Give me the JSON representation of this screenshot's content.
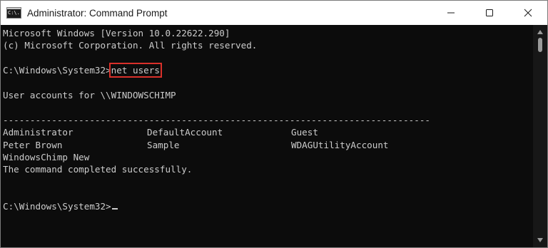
{
  "window": {
    "title": "Administrator: Command Prompt",
    "icon": "cmd-app-icon",
    "icon_glyph": "C:\\."
  },
  "controls": [
    "minimize-icon",
    "maximize-icon",
    "close-icon"
  ],
  "console": {
    "header1": "Microsoft Windows [Version 10.0.22622.290]",
    "header2": "(c) Microsoft Corporation. All rights reserved.",
    "prompt": "C:\\Windows\\System32>",
    "command": "net users",
    "accounts_header": "User accounts for \\\\WINDOWSCHIMP",
    "separator": "-------------------------------------------------------------------------------",
    "rows": [
      [
        "Administrator",
        "DefaultAccount",
        "Guest"
      ],
      [
        "Peter Brown",
        "Sample",
        "WDAGUtilityAccount"
      ],
      [
        "WindowsChimp New",
        "",
        ""
      ]
    ],
    "completion": "The command completed successfully.",
    "final_prompt": "C:\\Windows\\System32>"
  },
  "colors": {
    "console_bg": "#0c0c0c",
    "console_text": "#cccccc",
    "highlight": "#d9302a"
  }
}
